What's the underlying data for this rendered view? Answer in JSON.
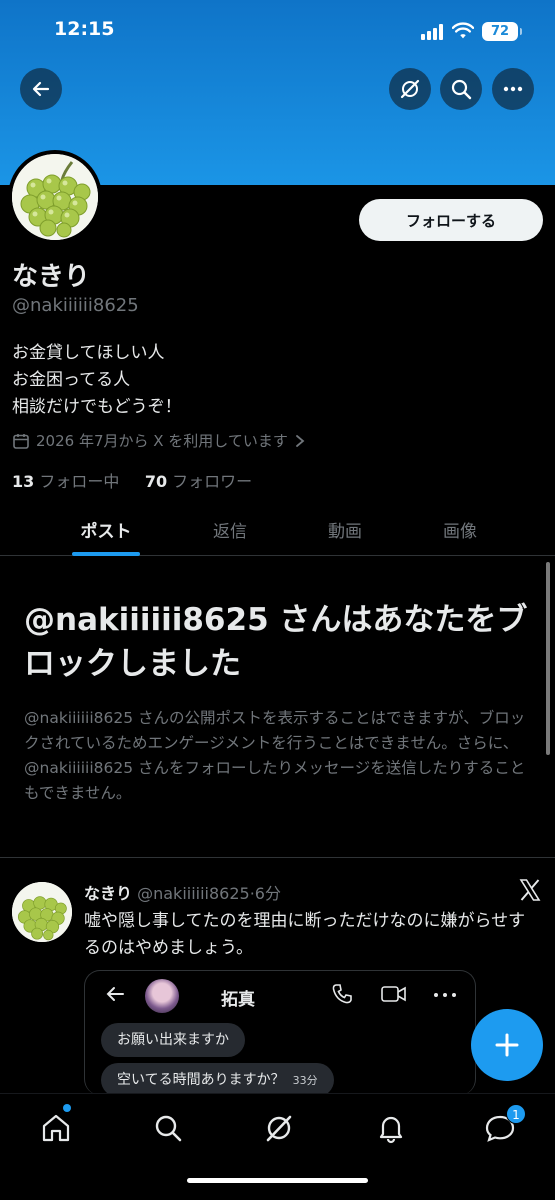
{
  "status_bar": {
    "time": "12:15",
    "battery": "72"
  },
  "profile": {
    "name": "なきり",
    "handle": "@nakiiiiii8625",
    "bio": [
      "お金貸してほしい人",
      "お金困ってる人",
      "相談だけでもどうぞ！"
    ],
    "joined": "2026 年7月から X を利用しています",
    "following_count": "13",
    "following_label": "フォロー中",
    "followers_count": "70",
    "followers_label": "フォロワー",
    "follow_button": "フォローする"
  },
  "tabs": [
    {
      "label": "ポスト",
      "active": true
    },
    {
      "label": "返信",
      "active": false
    },
    {
      "label": "動画",
      "active": false
    },
    {
      "label": "画像",
      "active": false
    }
  ],
  "blocked": {
    "title": "@nakiiiiii8625 さんはあなたをブロックしました",
    "description": "@nakiiiiii8625 さんの公開ポストを表示することはできますが、ブロックされているためエンゲージメントを行うことはできません。さらに、@nakiiiiii8625 さんをフォローしたりメッセージを送信したりすることもできません。"
  },
  "tweet": {
    "name": "なきり",
    "handle_time": "@nakiiiiii8625·6分",
    "text": "嘘や隠し事してたのを理由に断っただけなのに嫌がらせするのはやめましょう。",
    "embed": {
      "contact_name": "拓真",
      "messages": [
        {
          "text": "お願い出来ますか",
          "time": ""
        },
        {
          "text": "空いてる時間ありますか？",
          "time": "33分"
        }
      ]
    }
  },
  "nav": {
    "messages_badge": "1"
  },
  "colors": {
    "accent": "#1d9bf0",
    "banner": "#1b95e6",
    "muted": "#71767b",
    "background": "#000000"
  }
}
